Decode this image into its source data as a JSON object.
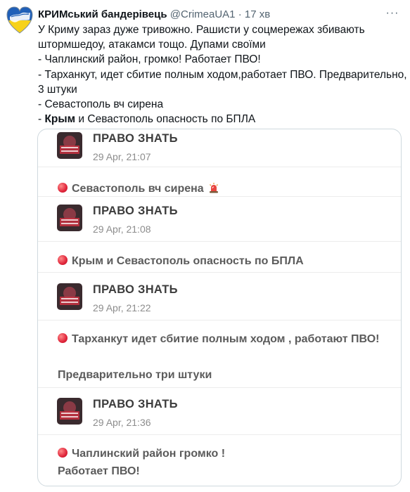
{
  "tweet": {
    "author_name": "КРИМський бандерівець",
    "handle": "@CrimeaUA1",
    "separator": "·",
    "time_ago": "17 хв",
    "more_label": "···",
    "avatar_icon": "crimea-ukraine-flag-heart-icon",
    "body_lines": [
      "У Криму зараз дуже тривожно. Рашисти у соцмережах збивають",
      "штормшедоу, атакамси тощо. Дупами своїми",
      "- Чаплинский район, громко! Работает ПВО!",
      "- Тарханкут, идет сбитие полным ходом,работает ПВО. Предварительно,",
      "3 штуки",
      "- Севастополь вч сирена"
    ],
    "last_line_prefix": "- ",
    "last_line_bold": "Крым",
    "last_line_rest": " и Севастополь опасность по БПЛА"
  },
  "quote": {
    "posts": [
      {
        "channel": "ПРАВО ЗНАТЬ",
        "date": "29 Apr, 21:07",
        "message": "Севастополь вч сирена",
        "has_siren": true
      },
      {
        "channel": "ПРАВО ЗНАТЬ",
        "date": "29 Apr, 21:08",
        "message": "Крым и Севастополь опасность по БПЛА"
      },
      {
        "channel": "ПРАВО ЗНАТЬ",
        "date": "29 Apr, 21:22",
        "message": "Тарханкут идет сбитие полным ходом , работают ПВО!",
        "message2": "Предварительно три штуки"
      },
      {
        "channel": "ПРАВО ЗНАТЬ",
        "date": "29 Apr, 21:36",
        "message": "Чаплинский район громко !",
        "message2": "Работает ПВО!"
      }
    ],
    "channel_logo_icon": "pravo-znat-channel-logo-icon",
    "bullet_icon": "red-circle-icon",
    "siren_icon": "police-siren-icon",
    "colors": {
      "bullet": "#e0253a",
      "channel_name": "#3c3c3c",
      "message": "#5b5b5b",
      "date": "#8c8c8c",
      "border": "#cfd9de"
    }
  }
}
